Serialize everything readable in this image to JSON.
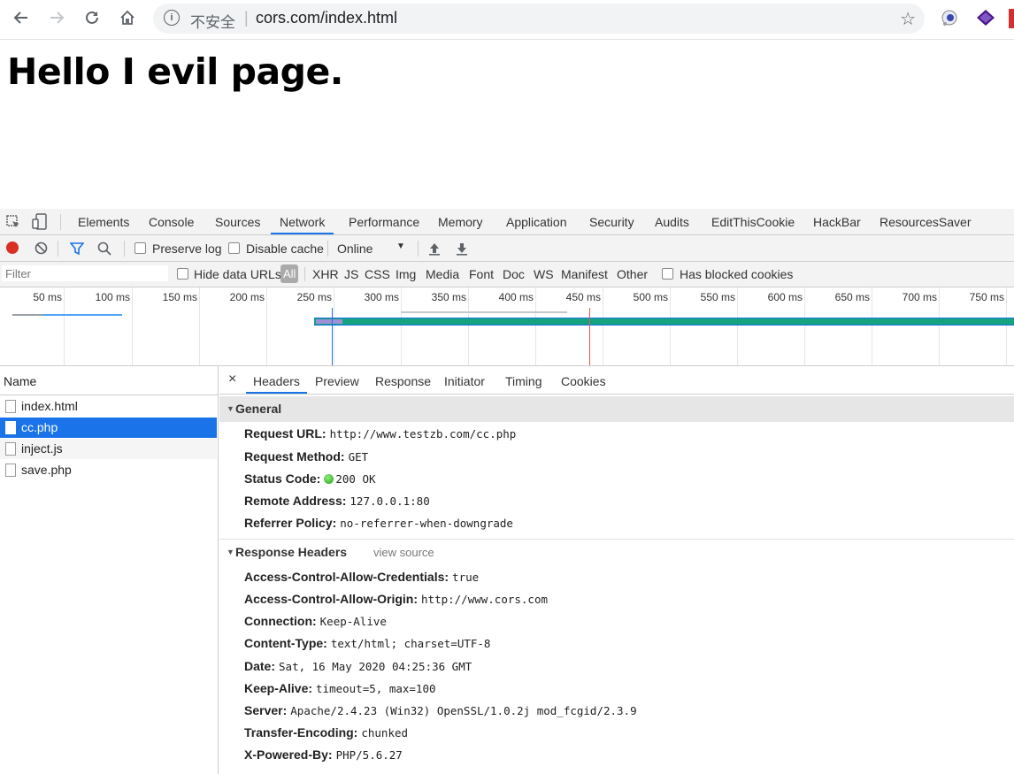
{
  "browser": {
    "security_label": "不安全",
    "separator": "|",
    "url": "cors.com/index.html"
  },
  "page": {
    "heading": "Hello I evil page."
  },
  "devtools": {
    "tabs": [
      "Elements",
      "Console",
      "Sources",
      "Network",
      "Performance",
      "Memory",
      "Application",
      "Security",
      "Audits",
      "EditThisCookie",
      "HackBar",
      "ResourcesSaver"
    ],
    "active_tab": "Network",
    "toolbar": {
      "preserve_log": "Preserve log",
      "disable_cache": "Disable cache",
      "throttle": "Online"
    },
    "filter": {
      "placeholder": "Filter",
      "hide_data_urls": "Hide data URLs",
      "types": [
        "All",
        "XHR",
        "JS",
        "CSS",
        "Img",
        "Media",
        "Font",
        "Doc",
        "WS",
        "Manifest",
        "Other"
      ],
      "has_blocked_cookies": "Has blocked cookies"
    },
    "timeline_ticks": [
      "50 ms",
      "100 ms",
      "150 ms",
      "200 ms",
      "250 ms",
      "300 ms",
      "350 ms",
      "400 ms",
      "450 ms",
      "500 ms",
      "550 ms",
      "600 ms",
      "650 ms",
      "700 ms",
      "750 ms"
    ],
    "requests": {
      "header": "Name",
      "items": [
        "index.html",
        "cc.php",
        "inject.js",
        "save.php"
      ],
      "selected": "cc.php"
    },
    "detail": {
      "close": "×",
      "tabs": [
        "Headers",
        "Preview",
        "Response",
        "Initiator",
        "Timing",
        "Cookies"
      ],
      "general": {
        "title": "General",
        "rows": [
          {
            "k": "Request URL:",
            "v": "http://www.testzb.com/cc.php"
          },
          {
            "k": "Request Method:",
            "v": "GET"
          },
          {
            "k": "Status Code:",
            "v": "200 OK"
          },
          {
            "k": "Remote Address:",
            "v": "127.0.0.1:80"
          },
          {
            "k": "Referrer Policy:",
            "v": "no-referrer-when-downgrade"
          }
        ]
      },
      "response_headers": {
        "title": "Response Headers",
        "view_source": "view source",
        "rows": [
          {
            "k": "Access-Control-Allow-Credentials:",
            "v": "true"
          },
          {
            "k": "Access-Control-Allow-Origin:",
            "v": "http://www.cors.com"
          },
          {
            "k": "Connection:",
            "v": "Keep-Alive"
          },
          {
            "k": "Content-Type:",
            "v": "text/html; charset=UTF-8"
          },
          {
            "k": "Date:",
            "v": "Sat, 16 May 2020 04:25:36 GMT"
          },
          {
            "k": "Keep-Alive:",
            "v": "timeout=5, max=100"
          },
          {
            "k": "Server:",
            "v": "Apache/2.4.23 (Win32) OpenSSL/1.0.2j mod_fcgid/2.3.9"
          },
          {
            "k": "Transfer-Encoding:",
            "v": "chunked"
          },
          {
            "k": "X-Powered-By:",
            "v": "PHP/5.6.27"
          }
        ]
      }
    }
  }
}
